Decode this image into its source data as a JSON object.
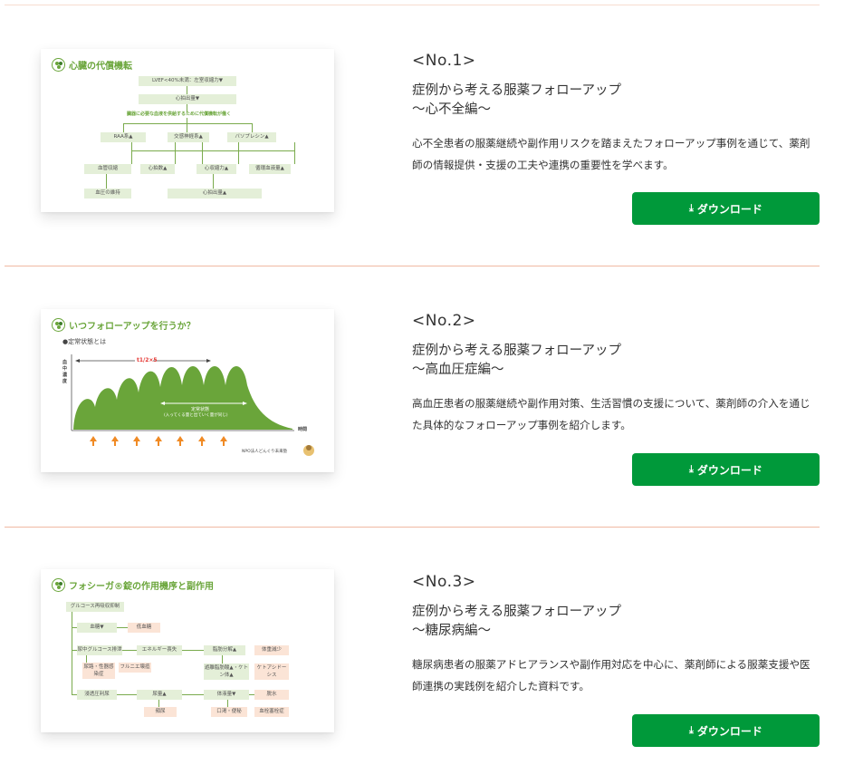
{
  "articles": [
    {
      "number": "<No.1>",
      "title_line1": "症例から考える服薬フォローアップ",
      "title_line2": "〜心不全編〜",
      "description": "心不全患者の服薬継続や副作用リスクを踏まえたフォローアップ事例を通じて、薬剤師の情報提供・支援の工夫や連携の重要性を学べます。",
      "download_label": "ダウンロード",
      "thumb": {
        "title": "心臓の代償機転",
        "boxes": [
          "LVEF<40%未満：左室収縮力▼",
          "心拍出量▼",
          "RAA系▲",
          "交感神経系▲",
          "バソプレシン▲",
          "血管収縮",
          "心拍数▲",
          "心収縮力▲",
          "循環血液量▲",
          "血圧の維持",
          "心拍出量▲"
        ],
        "note": "臓器に必要な血液を供給するために代償機転が働く"
      }
    },
    {
      "number": "<No.2>",
      "title_line1": "症例から考える服薬フォローアップ",
      "title_line2": "〜高血圧症編〜",
      "description": "高血圧患者の服薬継続や副作用対策、生活習慣の支援について、薬剤師の介入を通じた具体的なフォローアップ事例を紹介します。",
      "download_label": "ダウンロード",
      "thumb": {
        "title": "いつフォローアップを行うか？",
        "subtitle": "●定常状態とは",
        "ylabel": "血中濃度",
        "xlabel": "時間",
        "half_life": "t1/2×5",
        "steady_label": "定常状態",
        "steady_sub": "(入ってくる量と出ていく量が同じ)",
        "credit": "NPO法人どんぐり未来塾"
      }
    },
    {
      "number": "<No.3>",
      "title_line1": "症例から考える服薬フォローアップ",
      "title_line2": "〜糖尿病編〜",
      "description": "糖尿病患者の服薬アドヒアランスや副作用対応を中心に、薬剤師による服薬支援や医師連携の実践例を紹介した資料です。",
      "download_label": "ダウンロード",
      "thumb": {
        "title": "フォシーガ®錠の作用機序と副作用",
        "boxes": [
          "グルコース再吸収抑制",
          "血糖▼",
          "低血糖",
          "尿中グルコース排泄",
          "エネルギー喪失",
          "脂肪分解▲",
          "体重減少",
          "尿路・性器感染症",
          "フルニエ壊疽",
          "遊離脂肪酸▲・ケトン体▲",
          "ケトアシドーシス",
          "浸透圧利尿",
          "尿量▲",
          "体液量▼",
          "脱水",
          "頻尿",
          "口渇・便秘",
          "血栓塞栓症"
        ]
      }
    }
  ],
  "colors": {
    "accent_green": "#00993a",
    "divider": "#f0b9a3",
    "thumb_green": "#6aa53a"
  }
}
